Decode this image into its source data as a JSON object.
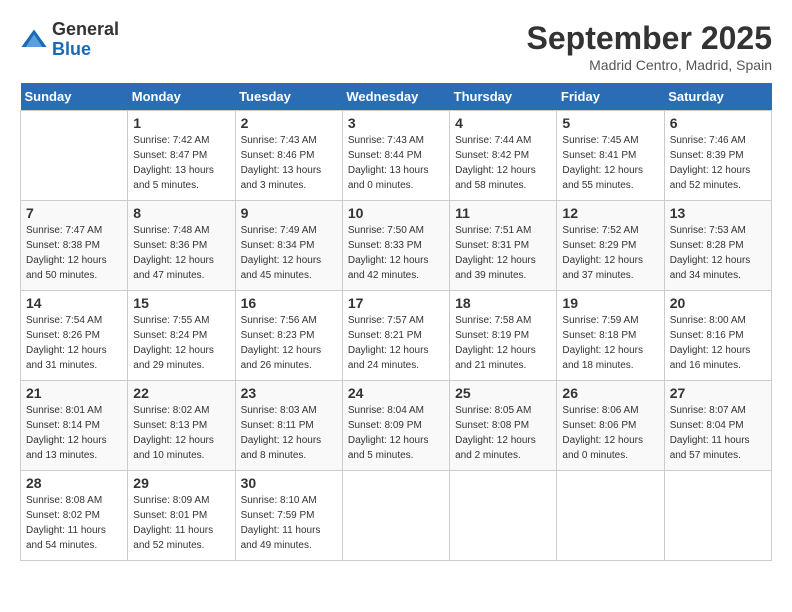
{
  "header": {
    "logo": {
      "general": "General",
      "blue": "Blue"
    },
    "title": "September 2025",
    "location": "Madrid Centro, Madrid, Spain"
  },
  "days_of_week": [
    "Sunday",
    "Monday",
    "Tuesday",
    "Wednesday",
    "Thursday",
    "Friday",
    "Saturday"
  ],
  "weeks": [
    [
      {
        "day": "",
        "info": ""
      },
      {
        "day": "1",
        "info": "Sunrise: 7:42 AM\nSunset: 8:47 PM\nDaylight: 13 hours\nand 5 minutes."
      },
      {
        "day": "2",
        "info": "Sunrise: 7:43 AM\nSunset: 8:46 PM\nDaylight: 13 hours\nand 3 minutes."
      },
      {
        "day": "3",
        "info": "Sunrise: 7:43 AM\nSunset: 8:44 PM\nDaylight: 13 hours\nand 0 minutes."
      },
      {
        "day": "4",
        "info": "Sunrise: 7:44 AM\nSunset: 8:42 PM\nDaylight: 12 hours\nand 58 minutes."
      },
      {
        "day": "5",
        "info": "Sunrise: 7:45 AM\nSunset: 8:41 PM\nDaylight: 12 hours\nand 55 minutes."
      },
      {
        "day": "6",
        "info": "Sunrise: 7:46 AM\nSunset: 8:39 PM\nDaylight: 12 hours\nand 52 minutes."
      }
    ],
    [
      {
        "day": "7",
        "info": "Sunrise: 7:47 AM\nSunset: 8:38 PM\nDaylight: 12 hours\nand 50 minutes."
      },
      {
        "day": "8",
        "info": "Sunrise: 7:48 AM\nSunset: 8:36 PM\nDaylight: 12 hours\nand 47 minutes."
      },
      {
        "day": "9",
        "info": "Sunrise: 7:49 AM\nSunset: 8:34 PM\nDaylight: 12 hours\nand 45 minutes."
      },
      {
        "day": "10",
        "info": "Sunrise: 7:50 AM\nSunset: 8:33 PM\nDaylight: 12 hours\nand 42 minutes."
      },
      {
        "day": "11",
        "info": "Sunrise: 7:51 AM\nSunset: 8:31 PM\nDaylight: 12 hours\nand 39 minutes."
      },
      {
        "day": "12",
        "info": "Sunrise: 7:52 AM\nSunset: 8:29 PM\nDaylight: 12 hours\nand 37 minutes."
      },
      {
        "day": "13",
        "info": "Sunrise: 7:53 AM\nSunset: 8:28 PM\nDaylight: 12 hours\nand 34 minutes."
      }
    ],
    [
      {
        "day": "14",
        "info": "Sunrise: 7:54 AM\nSunset: 8:26 PM\nDaylight: 12 hours\nand 31 minutes."
      },
      {
        "day": "15",
        "info": "Sunrise: 7:55 AM\nSunset: 8:24 PM\nDaylight: 12 hours\nand 29 minutes."
      },
      {
        "day": "16",
        "info": "Sunrise: 7:56 AM\nSunset: 8:23 PM\nDaylight: 12 hours\nand 26 minutes."
      },
      {
        "day": "17",
        "info": "Sunrise: 7:57 AM\nSunset: 8:21 PM\nDaylight: 12 hours\nand 24 minutes."
      },
      {
        "day": "18",
        "info": "Sunrise: 7:58 AM\nSunset: 8:19 PM\nDaylight: 12 hours\nand 21 minutes."
      },
      {
        "day": "19",
        "info": "Sunrise: 7:59 AM\nSunset: 8:18 PM\nDaylight: 12 hours\nand 18 minutes."
      },
      {
        "day": "20",
        "info": "Sunrise: 8:00 AM\nSunset: 8:16 PM\nDaylight: 12 hours\nand 16 minutes."
      }
    ],
    [
      {
        "day": "21",
        "info": "Sunrise: 8:01 AM\nSunset: 8:14 PM\nDaylight: 12 hours\nand 13 minutes."
      },
      {
        "day": "22",
        "info": "Sunrise: 8:02 AM\nSunset: 8:13 PM\nDaylight: 12 hours\nand 10 minutes."
      },
      {
        "day": "23",
        "info": "Sunrise: 8:03 AM\nSunset: 8:11 PM\nDaylight: 12 hours\nand 8 minutes."
      },
      {
        "day": "24",
        "info": "Sunrise: 8:04 AM\nSunset: 8:09 PM\nDaylight: 12 hours\nand 5 minutes."
      },
      {
        "day": "25",
        "info": "Sunrise: 8:05 AM\nSunset: 8:08 PM\nDaylight: 12 hours\nand 2 minutes."
      },
      {
        "day": "26",
        "info": "Sunrise: 8:06 AM\nSunset: 8:06 PM\nDaylight: 12 hours\nand 0 minutes."
      },
      {
        "day": "27",
        "info": "Sunrise: 8:07 AM\nSunset: 8:04 PM\nDaylight: 11 hours\nand 57 minutes."
      }
    ],
    [
      {
        "day": "28",
        "info": "Sunrise: 8:08 AM\nSunset: 8:02 PM\nDaylight: 11 hours\nand 54 minutes."
      },
      {
        "day": "29",
        "info": "Sunrise: 8:09 AM\nSunset: 8:01 PM\nDaylight: 11 hours\nand 52 minutes."
      },
      {
        "day": "30",
        "info": "Sunrise: 8:10 AM\nSunset: 7:59 PM\nDaylight: 11 hours\nand 49 minutes."
      },
      {
        "day": "",
        "info": ""
      },
      {
        "day": "",
        "info": ""
      },
      {
        "day": "",
        "info": ""
      },
      {
        "day": "",
        "info": ""
      }
    ]
  ]
}
